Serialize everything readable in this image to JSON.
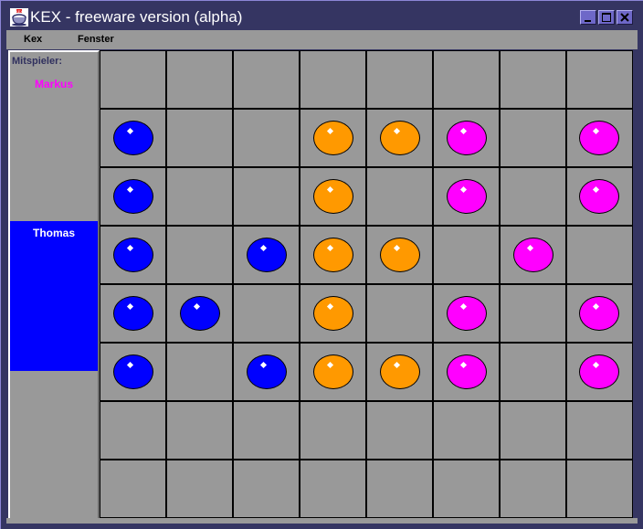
{
  "window": {
    "title": "KEX - freeware version (alpha)",
    "controls": [
      {
        "name": "minimize",
        "icon": "minimize-icon"
      },
      {
        "name": "maximize",
        "icon": "maximize-icon"
      },
      {
        "name": "close",
        "icon": "close-icon"
      }
    ]
  },
  "menu": {
    "items": [
      {
        "label": "Kex"
      },
      {
        "label": "Fenster"
      }
    ]
  },
  "sidebar": {
    "title": "Mitspieler:",
    "players": [
      {
        "name": "Markus",
        "color": "#ff00ff",
        "active": false
      },
      {
        "name": "Thomas",
        "color": "#0000ff",
        "active": true
      }
    ]
  },
  "board": {
    "rows": 8,
    "cols": 8,
    "colors": {
      "B": "#0000ff",
      "O": "#ff9900",
      "M": "#ff00ff"
    },
    "grid": [
      [
        "",
        "",
        "",
        "",
        "",
        "",
        "",
        ""
      ],
      [
        "B",
        "",
        "",
        "O",
        "O",
        "M",
        "",
        "M"
      ],
      [
        "B",
        "",
        "",
        "O",
        "",
        "M",
        "",
        "M"
      ],
      [
        "B",
        "",
        "B",
        "O",
        "O",
        "",
        "M",
        ""
      ],
      [
        "B",
        "B",
        "",
        "O",
        "",
        "M",
        "",
        "M"
      ],
      [
        "B",
        "",
        "B",
        "O",
        "O",
        "M",
        "",
        "M"
      ],
      [
        "",
        "",
        "",
        "",
        "",
        "",
        "",
        ""
      ],
      [
        "",
        "",
        "",
        "",
        "",
        "",
        "",
        ""
      ]
    ]
  }
}
